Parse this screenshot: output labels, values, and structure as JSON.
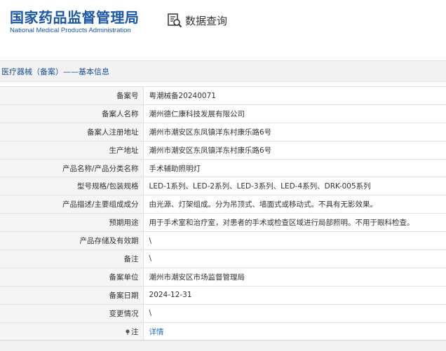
{
  "header": {
    "logo_cn": "国家药品监督管理局",
    "logo_en": "National Medical Products Administration",
    "query_label": "数据查询",
    "query_icon": "search-document-icon",
    "brand_color": "#1c57a6"
  },
  "breadcrumb": "医疗器械（备案）——基本信息",
  "rows": [
    {
      "label": "备案号",
      "value": "粤潮械备20240071"
    },
    {
      "label": "备案人名称",
      "value": "潮州德仁康科技发展有限公司"
    },
    {
      "label": "备案人注册地址",
      "value": "潮州市潮安区东凤镇洋东村康乐路6号"
    },
    {
      "label": "生产地址",
      "value": "潮州市潮安区东凤镇洋东村康乐路6号"
    },
    {
      "label": "产品名称/产品分类名称",
      "value": "手术辅助照明灯"
    },
    {
      "label": "型号规格/包装规格",
      "value": "LED-1系列、LED-2系列、LED-3系列、LED-4系列、DRK-005系列"
    },
    {
      "label": "产品描述/主要组成成分",
      "value": "由光源、灯架组成。分为吊顶式、墙面式或移动式。不具有无影效果。"
    },
    {
      "label": "预期用途",
      "value": "用于手术室和治疗室，对患者的手术或检查区域进行局部照明。不用于眼科检查。"
    },
    {
      "label": "产品存储及有效期",
      "value": "\\"
    },
    {
      "label": "备注",
      "value": "\\"
    },
    {
      "label": "备案单位",
      "value": "潮州市潮安区市场监督管理局"
    },
    {
      "label": "备案日期",
      "value": "2024-12-31"
    },
    {
      "label": "变更情况",
      "value": "\\"
    },
    {
      "label": "注",
      "value": "详情",
      "icon": "pin-icon"
    }
  ],
  "colors": {
    "link": "#2a6ebb",
    "label_bg": "#f5f5f5",
    "breadcrumb_text": "#1a4f95"
  }
}
